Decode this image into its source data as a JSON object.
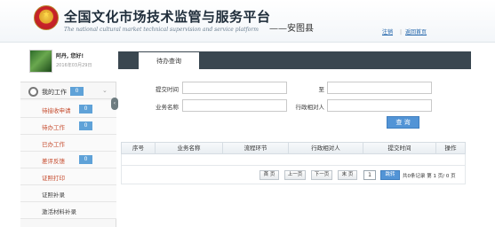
{
  "header": {
    "title": "全国文化市场技术监管与服务平台",
    "subtitle": "The national cultural market technical supervision and service platform",
    "region": "——安图县",
    "links": [
      "注销",
      "返回首页"
    ]
  },
  "sidebar": {
    "greeting": "阿丹, 您好!",
    "login_date": "2016年03月29日",
    "menu_title": "我的工作",
    "menu_badge": "0",
    "items": [
      {
        "label": "待接收申请",
        "badge": "0"
      },
      {
        "label": "待办工作",
        "badge": "0"
      },
      {
        "label": "已办工作",
        "badge": ""
      },
      {
        "label": "差评反馈",
        "badge": "0"
      },
      {
        "label": "证照打印",
        "badge": ""
      },
      {
        "label": "证照补录",
        "badge": ""
      },
      {
        "label": "激活材料补录",
        "badge": ""
      }
    ]
  },
  "main": {
    "tab": "待办查询",
    "form": {
      "submit_time_label": "提交时间",
      "to_label": "至",
      "business_name_label": "业务名称",
      "administrative_counterpart_label": "行政相对人",
      "search_button": "查 询"
    },
    "table": {
      "columns": [
        "序号",
        "业务名称",
        "流程环节",
        "行政相对人",
        "提交时间",
        "操作"
      ]
    },
    "pager": {
      "first": "首 页",
      "prev": "上一页",
      "next": "下一页",
      "last": "末 页",
      "page_value": "1",
      "go": "跳转",
      "info": "共0条记录 第 1 页/ 0 页"
    }
  },
  "colors": {
    "tab_strip": "#3a4750",
    "accent_blue": "#5294d6",
    "badge_blue": "#5fa2d8",
    "menu_text_red": "#c54a2c"
  }
}
